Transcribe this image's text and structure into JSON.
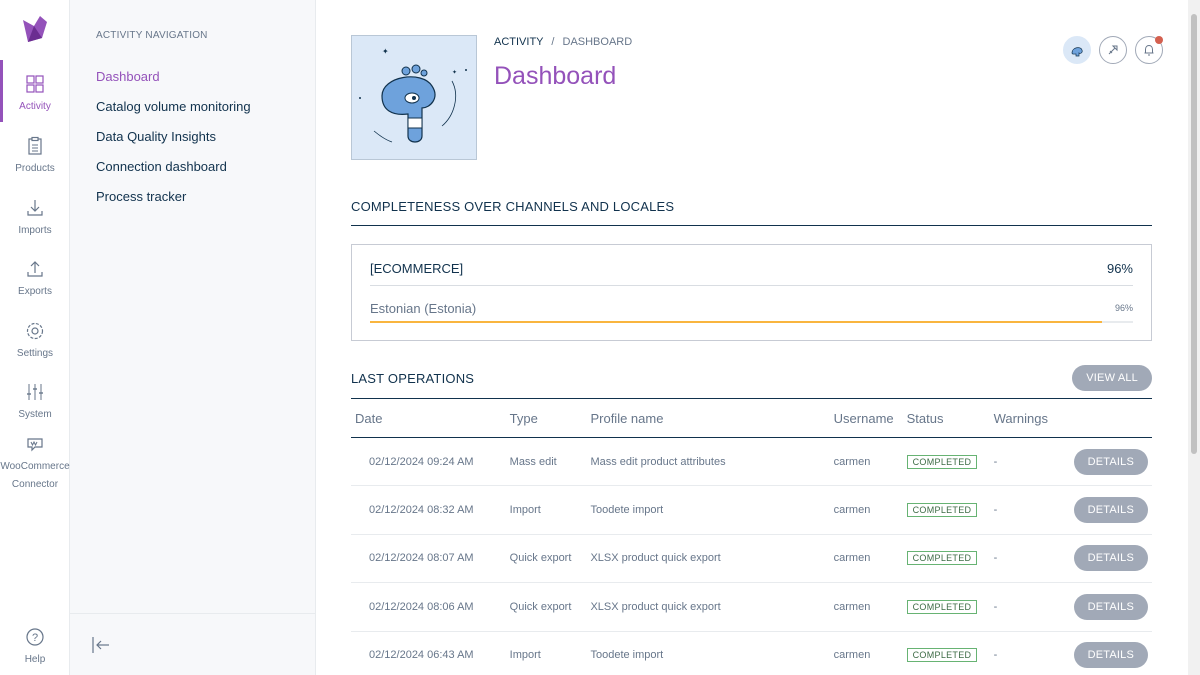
{
  "rail": {
    "items": [
      {
        "label": "Activity"
      },
      {
        "label": "Products"
      },
      {
        "label": "Imports"
      },
      {
        "label": "Exports"
      },
      {
        "label": "Settings"
      },
      {
        "label": "System"
      },
      {
        "label": "WooCommerce Connector"
      }
    ],
    "help_label": "Help"
  },
  "subnav": {
    "title": "ACTIVITY NAVIGATION",
    "links": [
      {
        "label": "Dashboard"
      },
      {
        "label": "Catalog volume monitoring"
      },
      {
        "label": "Data Quality Insights"
      },
      {
        "label": "Connection dashboard"
      },
      {
        "label": "Process tracker"
      }
    ]
  },
  "header": {
    "breadcrumb_first": "ACTIVITY",
    "breadcrumb_sep": "/",
    "breadcrumb_current": "DASHBOARD",
    "title": "Dashboard"
  },
  "completeness": {
    "title": "COMPLETENESS OVER CHANNELS AND LOCALES",
    "channel": "[ECOMMERCE]",
    "channel_ratio": "96%",
    "locale": "Estonian (Estonia)",
    "locale_ratio": "96%",
    "locale_fill_percent": 96
  },
  "operations": {
    "title": "LAST OPERATIONS",
    "view_all_label": "VIEW ALL",
    "columns": [
      "Date",
      "Type",
      "Profile name",
      "Username",
      "Status",
      "Warnings"
    ],
    "rows": [
      {
        "date": "02/12/2024 09:24 AM",
        "type": "Mass edit",
        "profile": "Mass edit product attributes",
        "username": "carmen",
        "status": "COMPLETED",
        "warnings": "-"
      },
      {
        "date": "02/12/2024 08:32 AM",
        "type": "Import",
        "profile": "Toodete import",
        "username": "carmen",
        "status": "COMPLETED",
        "warnings": "-"
      },
      {
        "date": "02/12/2024 08:07 AM",
        "type": "Quick export",
        "profile": "XLSX product quick export",
        "username": "carmen",
        "status": "COMPLETED",
        "warnings": "-"
      },
      {
        "date": "02/12/2024 08:06 AM",
        "type": "Quick export",
        "profile": "XLSX product quick export",
        "username": "carmen",
        "status": "COMPLETED",
        "warnings": "-"
      },
      {
        "date": "02/12/2024 06:43 AM",
        "type": "Import",
        "profile": "Toodete import",
        "username": "carmen",
        "status": "COMPLETED",
        "warnings": "-"
      }
    ],
    "details_label": "DETAILS"
  },
  "colors": {
    "accent": "#9452ba",
    "text": "#11324d",
    "muted": "#67768a",
    "button": "#a1a9b7",
    "progress": "#f9b53f",
    "success": "#67b373",
    "notification": "#d4604f"
  },
  "icons": [
    "akeneo-logo",
    "activity-icon",
    "products-icon",
    "imports-icon",
    "exports-icon",
    "settings-icon",
    "system-icon",
    "woocommerce-icon",
    "help-icon",
    "collapse-icon",
    "avatar-icon",
    "launch-icon",
    "bell-icon"
  ]
}
